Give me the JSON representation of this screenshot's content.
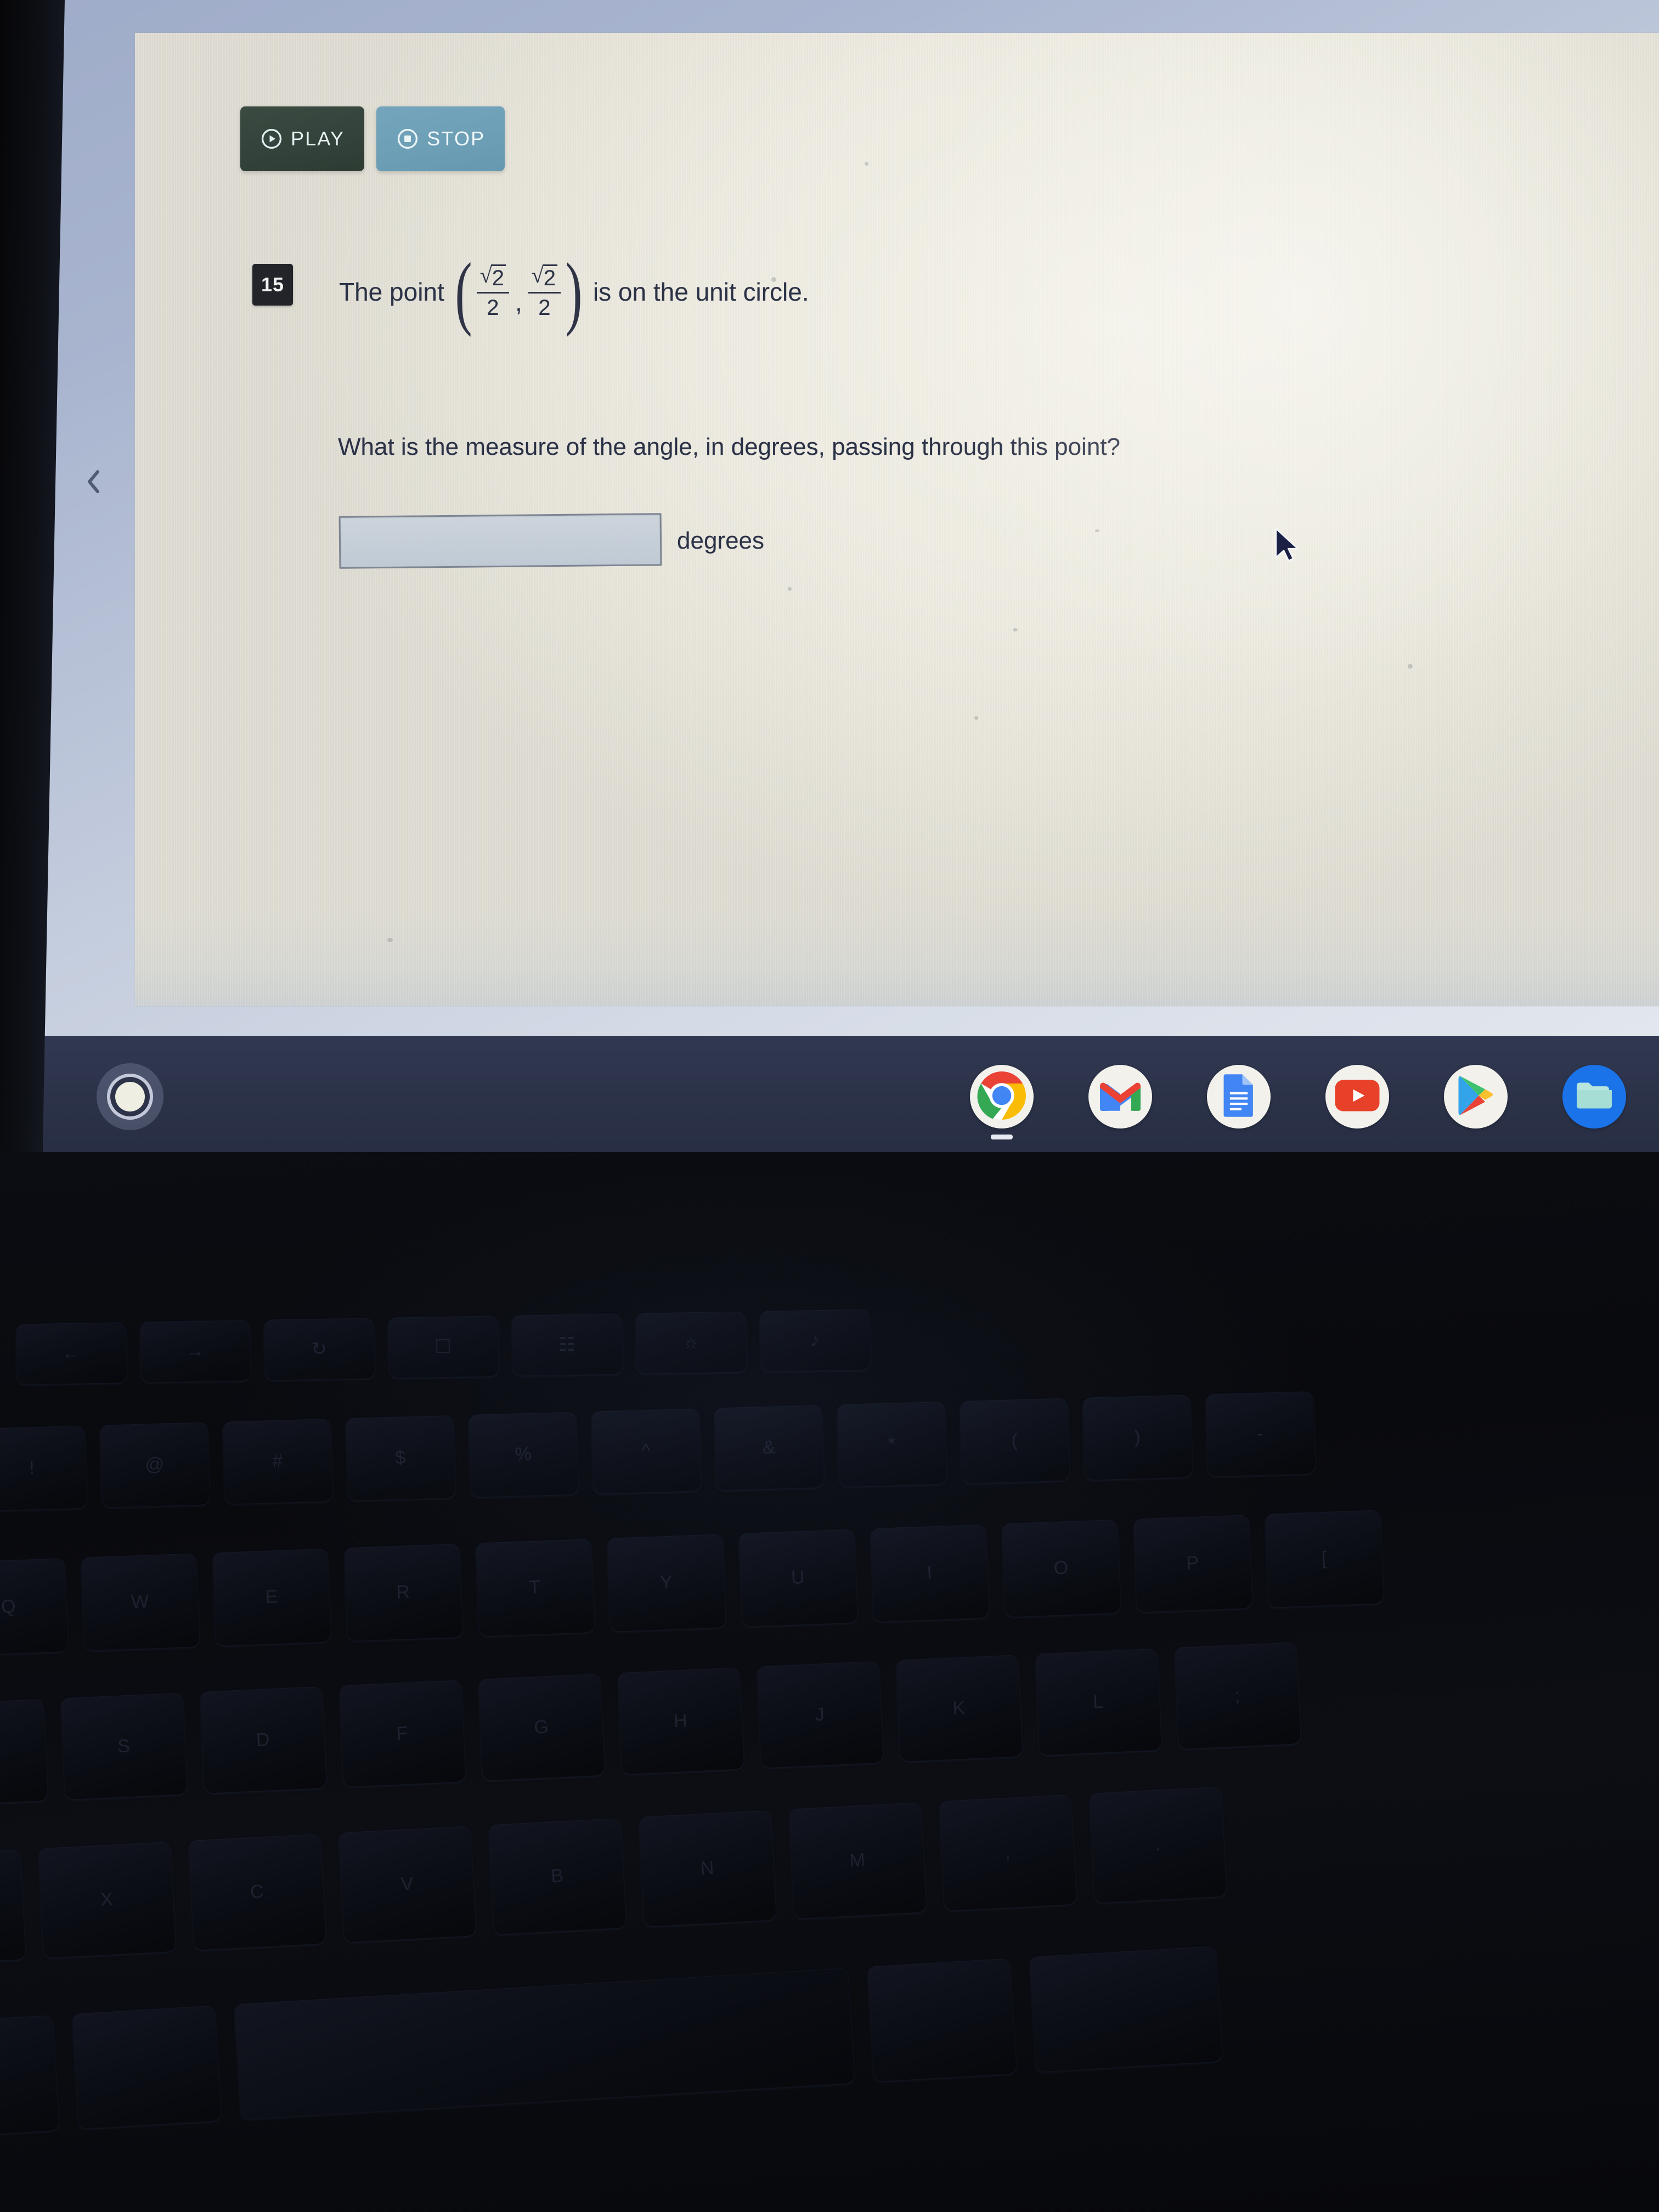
{
  "toolbar": {
    "play_label": "PLAY",
    "stop_label": "STOP",
    "play_color": "#33423a",
    "stop_color": "#6d9fb6"
  },
  "question": {
    "number": "15",
    "stem_prefix": "The point",
    "stem_suffix": "is on the unit circle.",
    "coordinate": {
      "x": {
        "numerator_root": "2",
        "denominator": "2"
      },
      "y": {
        "numerator_root": "2",
        "denominator": "2"
      },
      "separator": ","
    },
    "prompt": "What is the measure of the angle, in degrees, passing through this point?",
    "answer_value": "",
    "answer_placeholder": "",
    "unit_label": "degrees"
  },
  "navigation": {
    "back_chevron": "‹"
  },
  "shelf": {
    "launcher_name": "launcher",
    "apps": [
      {
        "name": "chrome",
        "label": "Chrome",
        "active": true,
        "style": "white"
      },
      {
        "name": "gmail",
        "label": "Gmail",
        "active": false,
        "style": "white"
      },
      {
        "name": "docs",
        "label": "Google Docs",
        "active": false,
        "style": "white"
      },
      {
        "name": "youtube",
        "label": "YouTube",
        "active": false,
        "style": "white"
      },
      {
        "name": "play-store",
        "label": "Google Play Store",
        "active": false,
        "style": "white"
      },
      {
        "name": "files",
        "label": "Files",
        "active": false,
        "style": "blue"
      }
    ]
  },
  "colors": {
    "shelf_bg": "#2c3349",
    "panel_bg": "#eeece2",
    "desktop_bg": "#c3ccdd",
    "text": "#2b3146",
    "input_bg": "#c6cfd8",
    "input_border": "#7d8492"
  }
}
